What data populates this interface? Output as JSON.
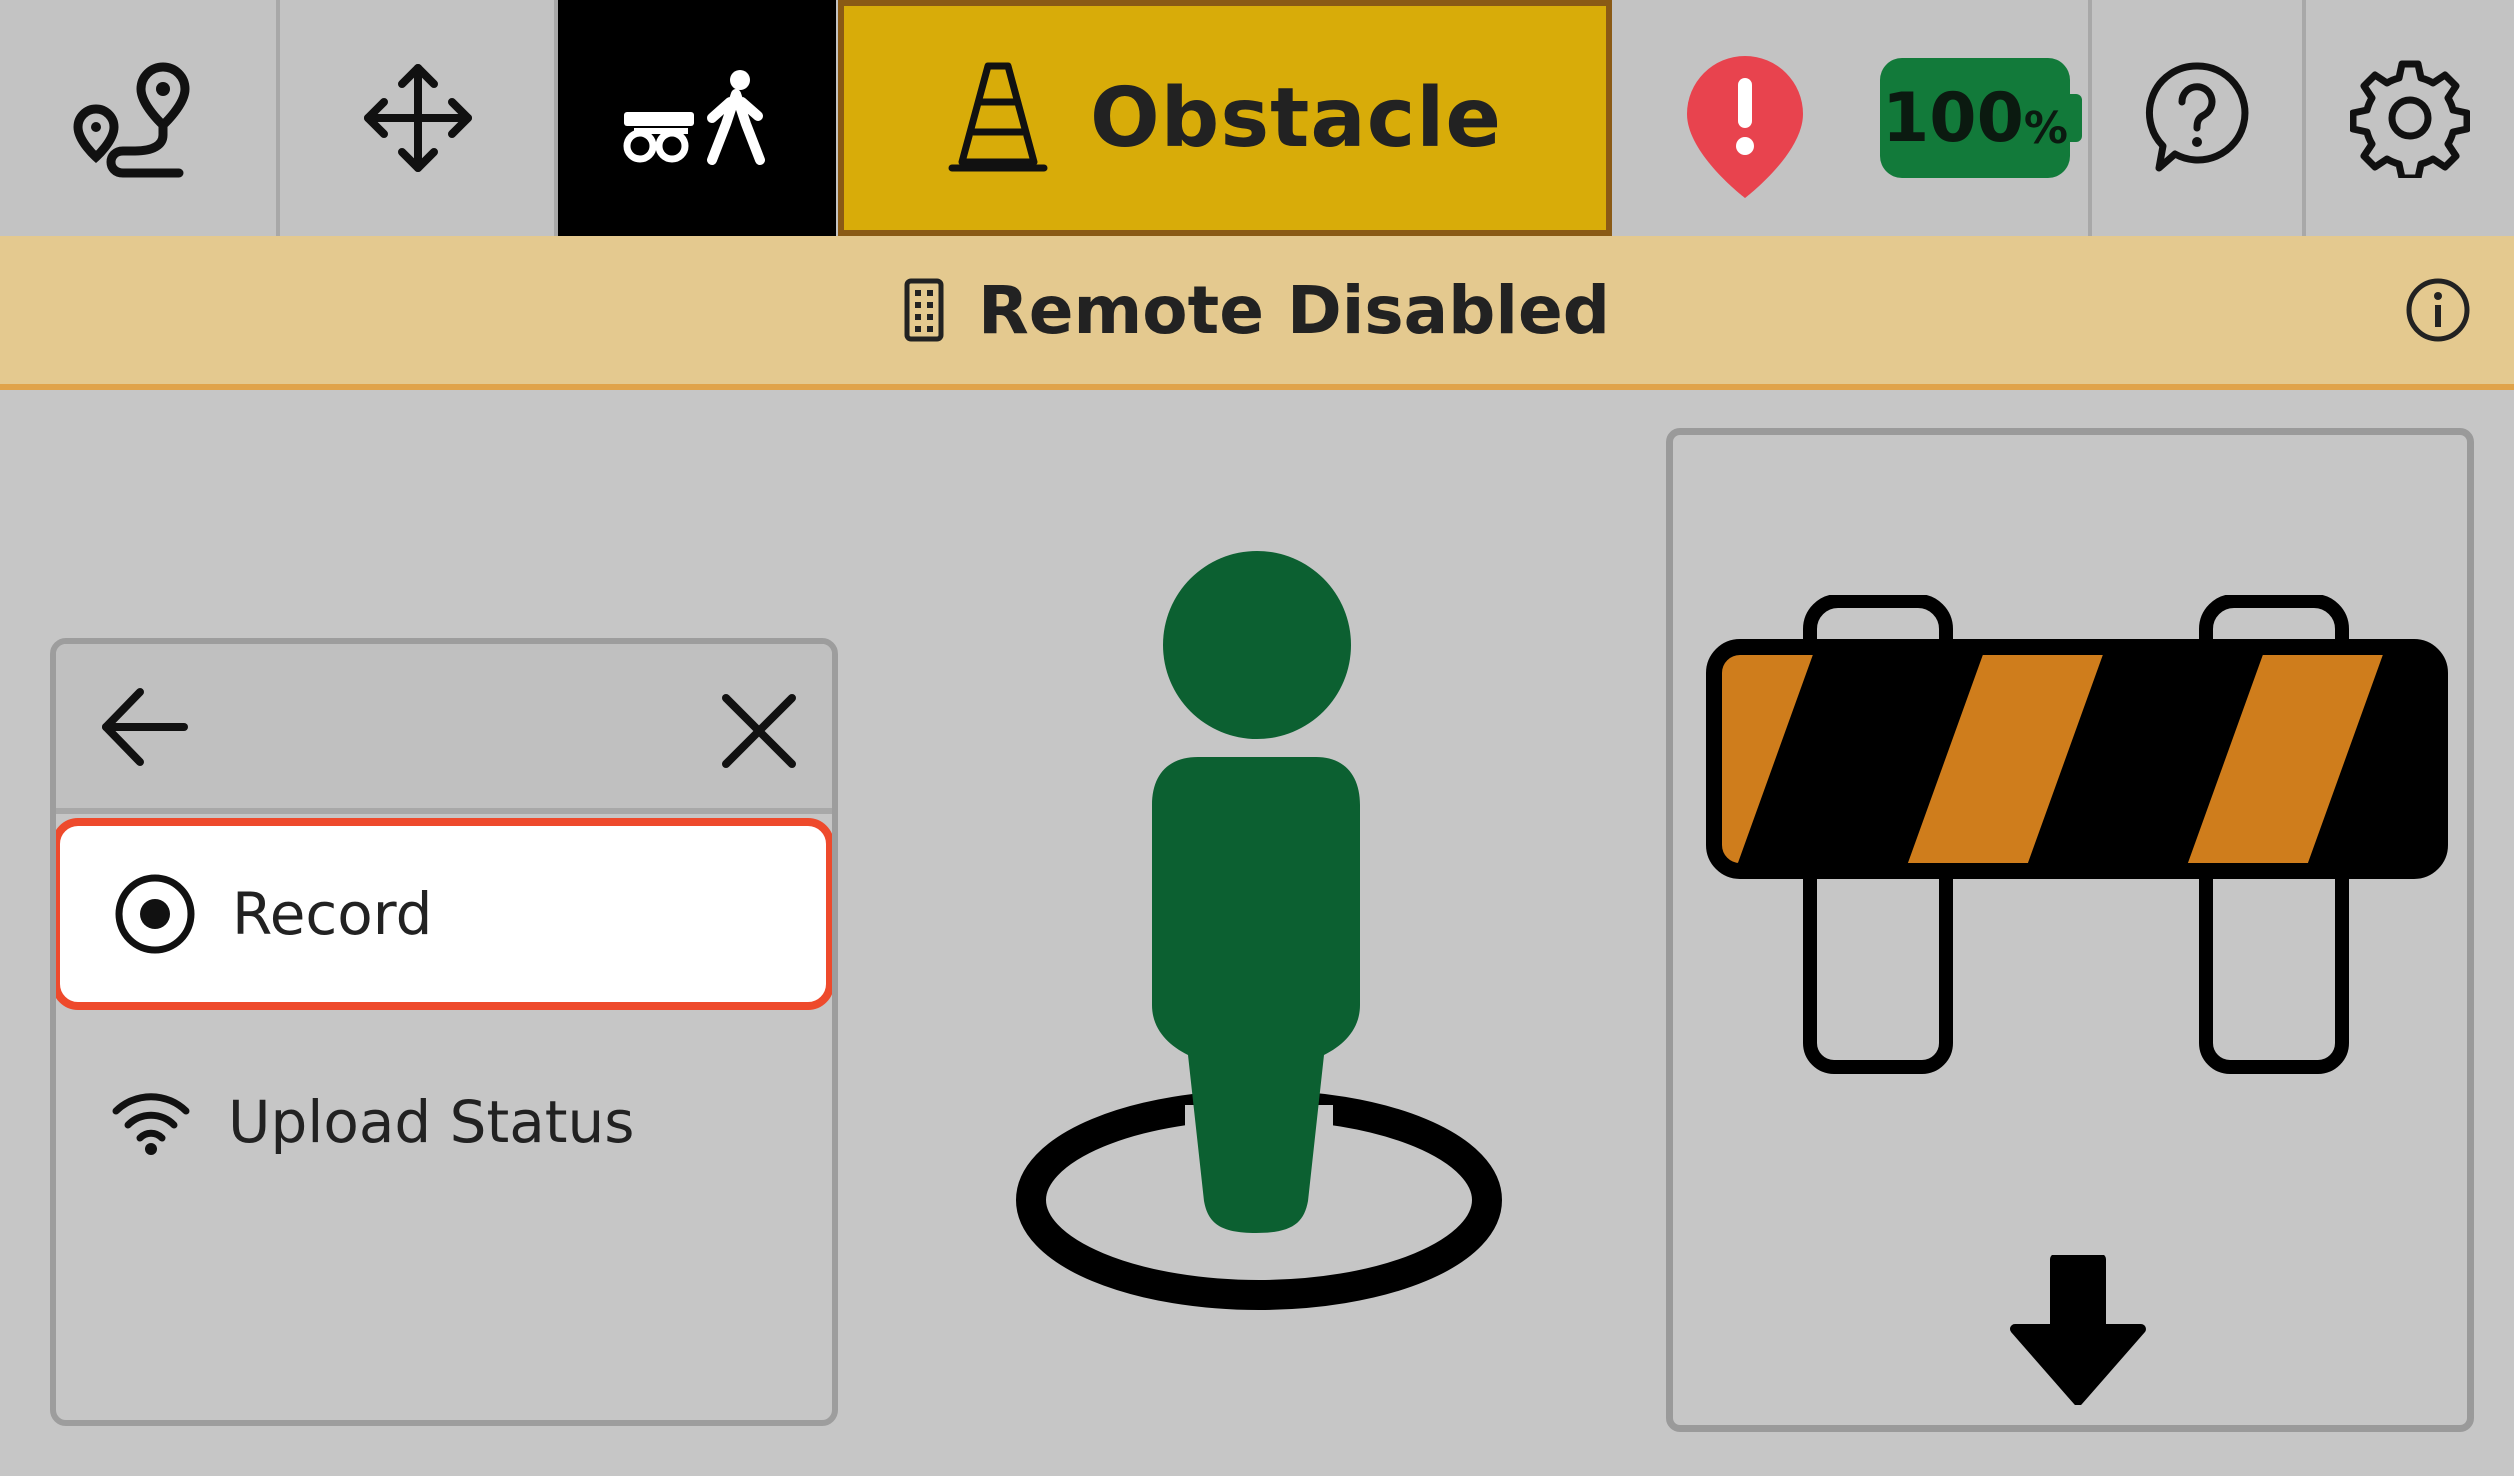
{
  "toolbar": {
    "mode_button": {
      "label": "Obstacle",
      "color": "#d8ac09"
    },
    "battery": {
      "value": "100",
      "unit": "%",
      "level": 1.0,
      "color": "#127a3a"
    },
    "alert_color": "#e8434e",
    "icons": [
      "route-icon",
      "move-arrows-icon",
      "robot-walker-icon",
      "traffic-cone-icon",
      "alert-pin-icon",
      "help-icon",
      "gear-icon"
    ]
  },
  "banner": {
    "text": "Remote Disabled",
    "background": "#e4c98f",
    "icons": [
      "remote-control-icon",
      "info-icon"
    ]
  },
  "menu": {
    "items": [
      {
        "label": "Record",
        "icon": "record-radio-icon",
        "selected": true
      },
      {
        "label": "Upload Status",
        "icon": "wifi-icon",
        "selected": false
      }
    ],
    "highlight_color": "#ee4a2c"
  },
  "marker": {
    "color": "#0c6031",
    "icon": "person-location-icon"
  },
  "obstacle_card": {
    "icons": [
      "barricade-icon",
      "down-arrow-icon"
    ],
    "stripe_color": "#cf7d1c"
  }
}
